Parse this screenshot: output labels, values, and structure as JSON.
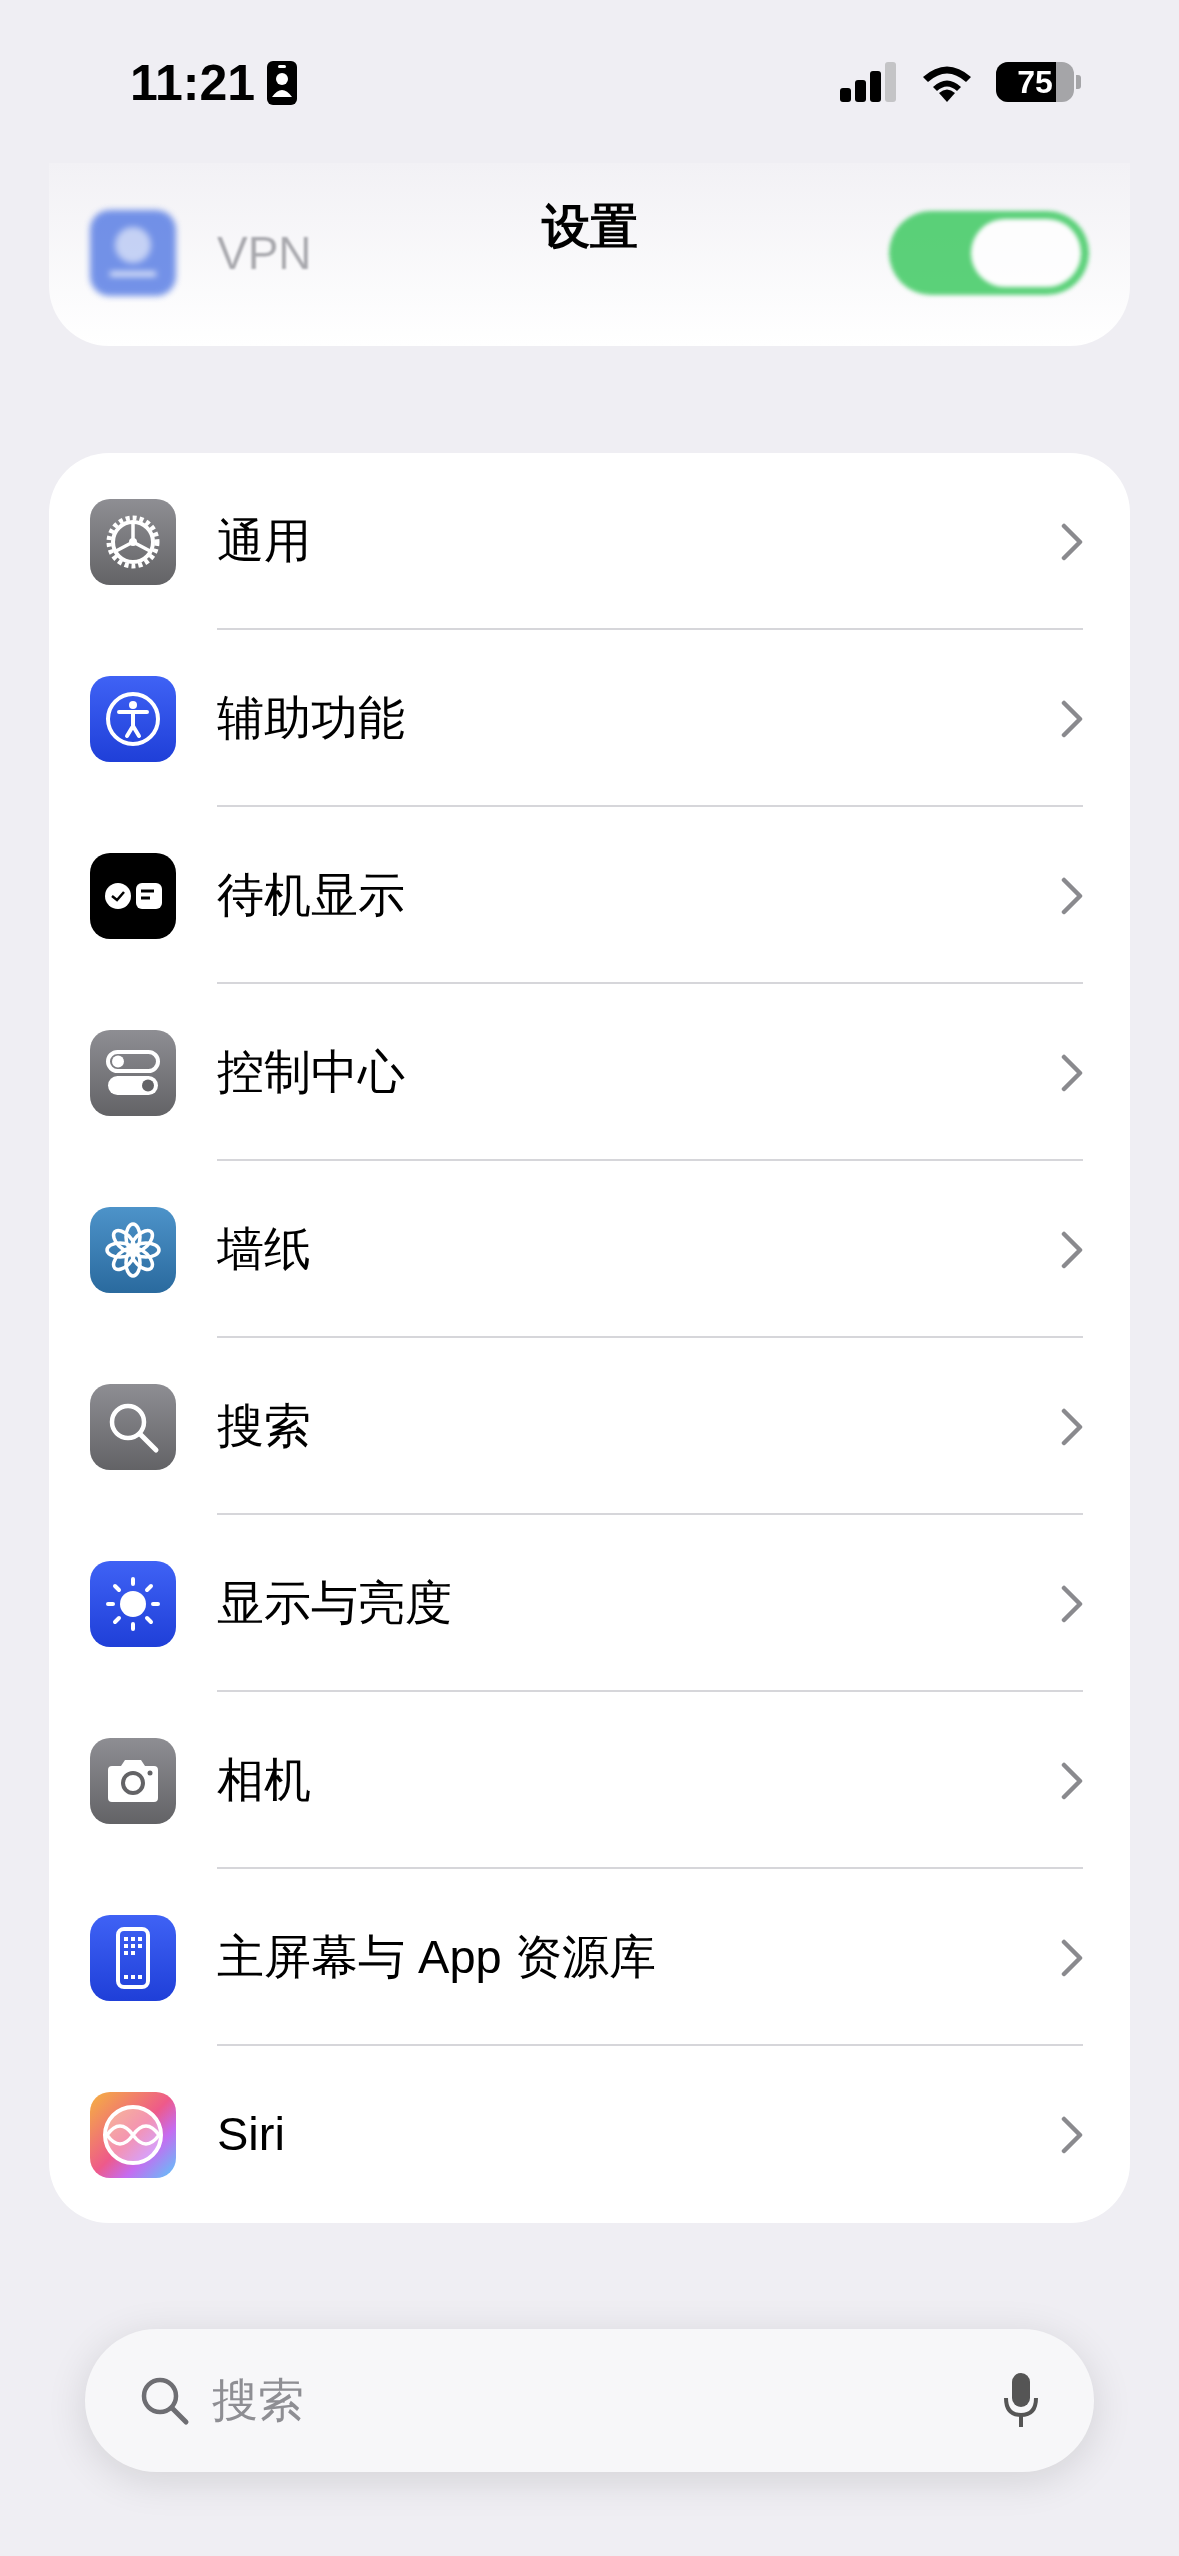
{
  "status_bar": {
    "time": "11:21",
    "battery": "75"
  },
  "title": "设置",
  "pinned_row": {
    "label": "VPN",
    "on": true
  },
  "items": [
    {
      "label": "通用"
    },
    {
      "label": "辅助功能"
    },
    {
      "label": "待机显示"
    },
    {
      "label": "控制中心"
    },
    {
      "label": "墙纸"
    },
    {
      "label": "搜索"
    },
    {
      "label": "显示与亮度"
    },
    {
      "label": "相机"
    },
    {
      "label": "主屏幕与 App 资源库"
    },
    {
      "label": "Siri"
    }
  ],
  "search": {
    "placeholder": "搜索"
  }
}
